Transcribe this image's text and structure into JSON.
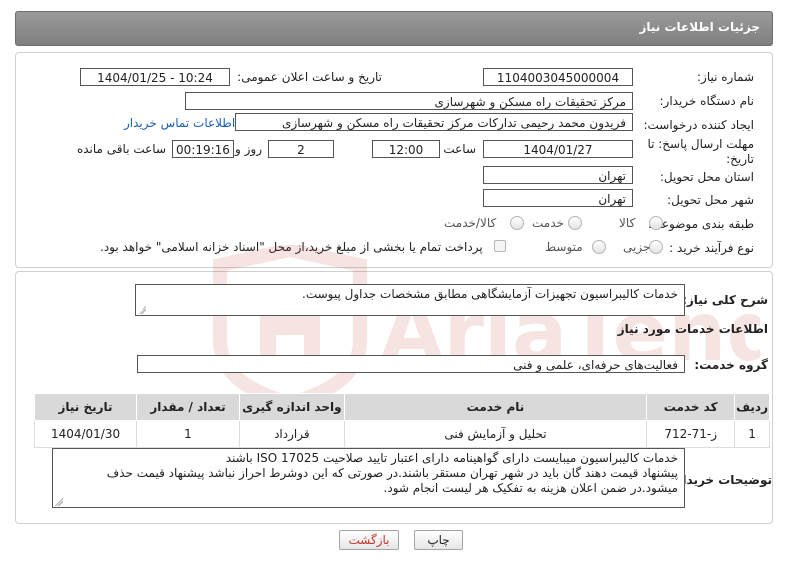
{
  "header": {
    "title": "جزئیات اطلاعات نیاز"
  },
  "need": {
    "number_label": "شماره نیاز:",
    "number_value": "1104003045000004",
    "announce_label": "تاریخ و ساعت اعلان عمومی:",
    "announce_value": "1404/01/25 - 10:24",
    "buyer_label": "نام دستگاه خریدار:",
    "buyer_value": "مرکز تحقیقات راه  مسکن و شهرسازی",
    "creator_label": "ایجاد کننده درخواست:",
    "creator_value": "فریدون محمد رحیمی تدارکات مرکز تحقیقات راه  مسکن و شهرسازی",
    "contact_link": "اطلاعات تماس خریدار",
    "deadline_label_1": "مهلت ارسال پاسخ: تا",
    "deadline_label_2": "تاریخ:",
    "deadline_date": "1404/01/27",
    "time_label": "ساعت",
    "deadline_time": "12:00",
    "days_value": "2",
    "days_label": "روز و",
    "remaining_value": "00:19:16",
    "remaining_label": "ساعت باقی مانده",
    "province_label": "استان محل تحویل:",
    "province_value": "تهران",
    "city_label": "شهر محل تحویل:",
    "city_value": "تهران",
    "category_label": "طبقه بندی موضوعی:",
    "category_options": [
      "کالا",
      "خدمت",
      "کالا/خدمت"
    ],
    "category_selected": "خدمت",
    "process_label": "نوع فرآیند خرید :",
    "process_options": [
      "جزیی",
      "متوسط"
    ],
    "payment_note": "پرداخت تمام یا بخشی از مبلغ خرید،از محل \"اسناد خزانه اسلامی\" خواهد بود."
  },
  "summary": {
    "label": "شرح کلی نیاز:",
    "value": "خدمات کالیبراسیون تجهیزات آزمایشگاهی مطابق مشخصات جداول پیوست."
  },
  "services": {
    "section_title": "اطلاعات خدمات مورد نیاز",
    "group_label": "گروه خدمت:",
    "group_value": "فعالیت‌های حرفه‌ای، علمی و فنی",
    "columns": [
      "ردیف",
      "کد خدمت",
      "نام خدمت",
      "واحد اندازه گیری",
      "تعداد / مقدار",
      "تاریخ نیاز"
    ],
    "rows": [
      [
        "1",
        "ز-71-712",
        "تحلیل و آزمایش فنی",
        "قرارداد",
        "1",
        "1404/01/30"
      ]
    ]
  },
  "buyer_notes": {
    "label": "توضیحات خریدار:",
    "line1": "خدمات کالیبراسیون میبایست دارای گواهینامه دارای اعتبار تایید صلاحیت ISO 17025 باشند",
    "line2": "پیشنهاد قیمت دهند گان باید  در شهر تهران مستقر باشند.در صورتی که این دوشرط احراز نباشد پیشنهاد قیمت حذف",
    "line3": "میشود.در ضمن اعلان هزینه به تفکیک هر لیست انجام شود."
  },
  "buttons": {
    "print": "چاپ",
    "back": "بازگشت"
  },
  "watermark": {
    "text": "AriaTender.net"
  },
  "colors": {
    "header_bg": "#8c8c8c",
    "link": "#1a5fb4",
    "back_text": "#c0392b",
    "watermark": "#c0392b"
  }
}
